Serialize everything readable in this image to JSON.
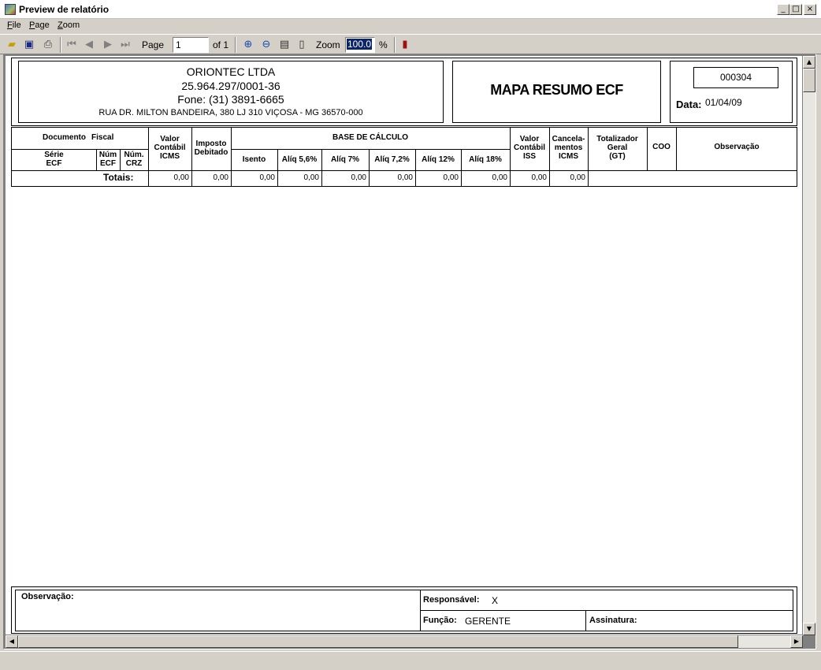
{
  "window": {
    "title": "Preview de relatório"
  },
  "menu": {
    "file": "File",
    "page": "Page",
    "zoom": "Zoom"
  },
  "toolbar": {
    "page_label": "Page",
    "page_value": "1",
    "page_of": "of 1",
    "zoom_label": "Zoom",
    "zoom_value": "100.0",
    "percent": "%",
    "icons": [
      "open-icon",
      "save-icon",
      "print-icon",
      "first-page-icon",
      "prev-page-icon",
      "next-page-icon",
      "last-page-icon",
      "zoom-in-icon",
      "zoom-out-icon",
      "page-width-icon",
      "whole-page-icon",
      "exit-icon"
    ]
  },
  "report": {
    "company": {
      "name": "ORIONTEC LTDA",
      "cnpj": "25.964.297/0001-36",
      "phone": "Fone:  (31) 3891-6665",
      "address": "RUA DR. MILTON BANDEIRA, 380  LJ 310  VIÇOSA - MG    36570-000"
    },
    "title": "MAPA RESUMO ECF",
    "number": "000304",
    "date_label": "Data:",
    "date_value": "01/04/09",
    "columns": {
      "doc_fiscal_a": "Documento",
      "doc_fiscal_b": "Fiscal",
      "serie": "Série\nECF",
      "num_ecf": "Núm\nECF",
      "num_crz": "Núm.\nCRZ",
      "valor_contabil_icms": "Valor\nContábil\nICMS",
      "imposto_debitado": "Imposto\nDebitado",
      "base_calculo": "BASE DE CÁLCULO",
      "isento": "Isento",
      "aliq_56": "Alíq 5,6%",
      "aliq_7": "Alíq 7%",
      "aliq_72": "Alíq 7,2%",
      "aliq_12": "Alíq 12%",
      "aliq_18": "Alíq 18%",
      "valor_contabil_iss": "Valor\nContábil\nISS",
      "cancelamentos": "Cancela-\nmentos\nICMS",
      "totalizador": "Totalizador\nGeral\n(GT)",
      "coo": "COO",
      "observacao": "Observação"
    },
    "totals": {
      "label": "Totais:",
      "valor_contabil_icms": "0,00",
      "imposto_debitado": "0,00",
      "isento": "0,00",
      "aliq_56": "0,00",
      "aliq_7": "0,00",
      "aliq_72": "0,00",
      "aliq_12": "0,00",
      "aliq_18": "0,00",
      "valor_contabil_iss": "0,00",
      "cancelamentos": "0,00"
    },
    "footer": {
      "observacao_label": "Observação:",
      "responsavel_label": "Responsável:",
      "responsavel_value": "X",
      "funcao_label": "Função:",
      "funcao_value": "GERENTE",
      "assinatura_label": "Assinatura:"
    }
  }
}
